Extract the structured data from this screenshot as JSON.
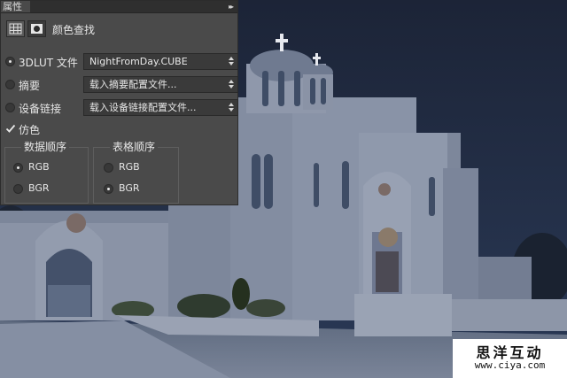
{
  "panel": {
    "tab_label": "属性",
    "collapse_glyph": "▸▸",
    "adjustment_title": "颜色查找",
    "rows": [
      {
        "label": "3DLUT 文件",
        "selected": true,
        "value": "NightFromDay.CUBE"
      },
      {
        "label": "摘要",
        "selected": false,
        "value": "载入摘要配置文件..."
      },
      {
        "label": "设备链接",
        "selected": false,
        "value": "载入设备链接配置文件..."
      }
    ],
    "dither": {
      "label": "仿色",
      "checked": true
    },
    "data_order": {
      "title": "数据顺序",
      "options": [
        "RGB",
        "BGR"
      ],
      "selected": "RGB"
    },
    "table_order": {
      "title": "表格顺序",
      "options": [
        "RGB",
        "BGR"
      ],
      "selected": "BGR"
    }
  },
  "watermark": {
    "title": "思洋互动",
    "url": "www.ciya.com"
  },
  "colors": {
    "panel_bg": "#4a4a4a",
    "night_sky": "#1f2a40"
  }
}
